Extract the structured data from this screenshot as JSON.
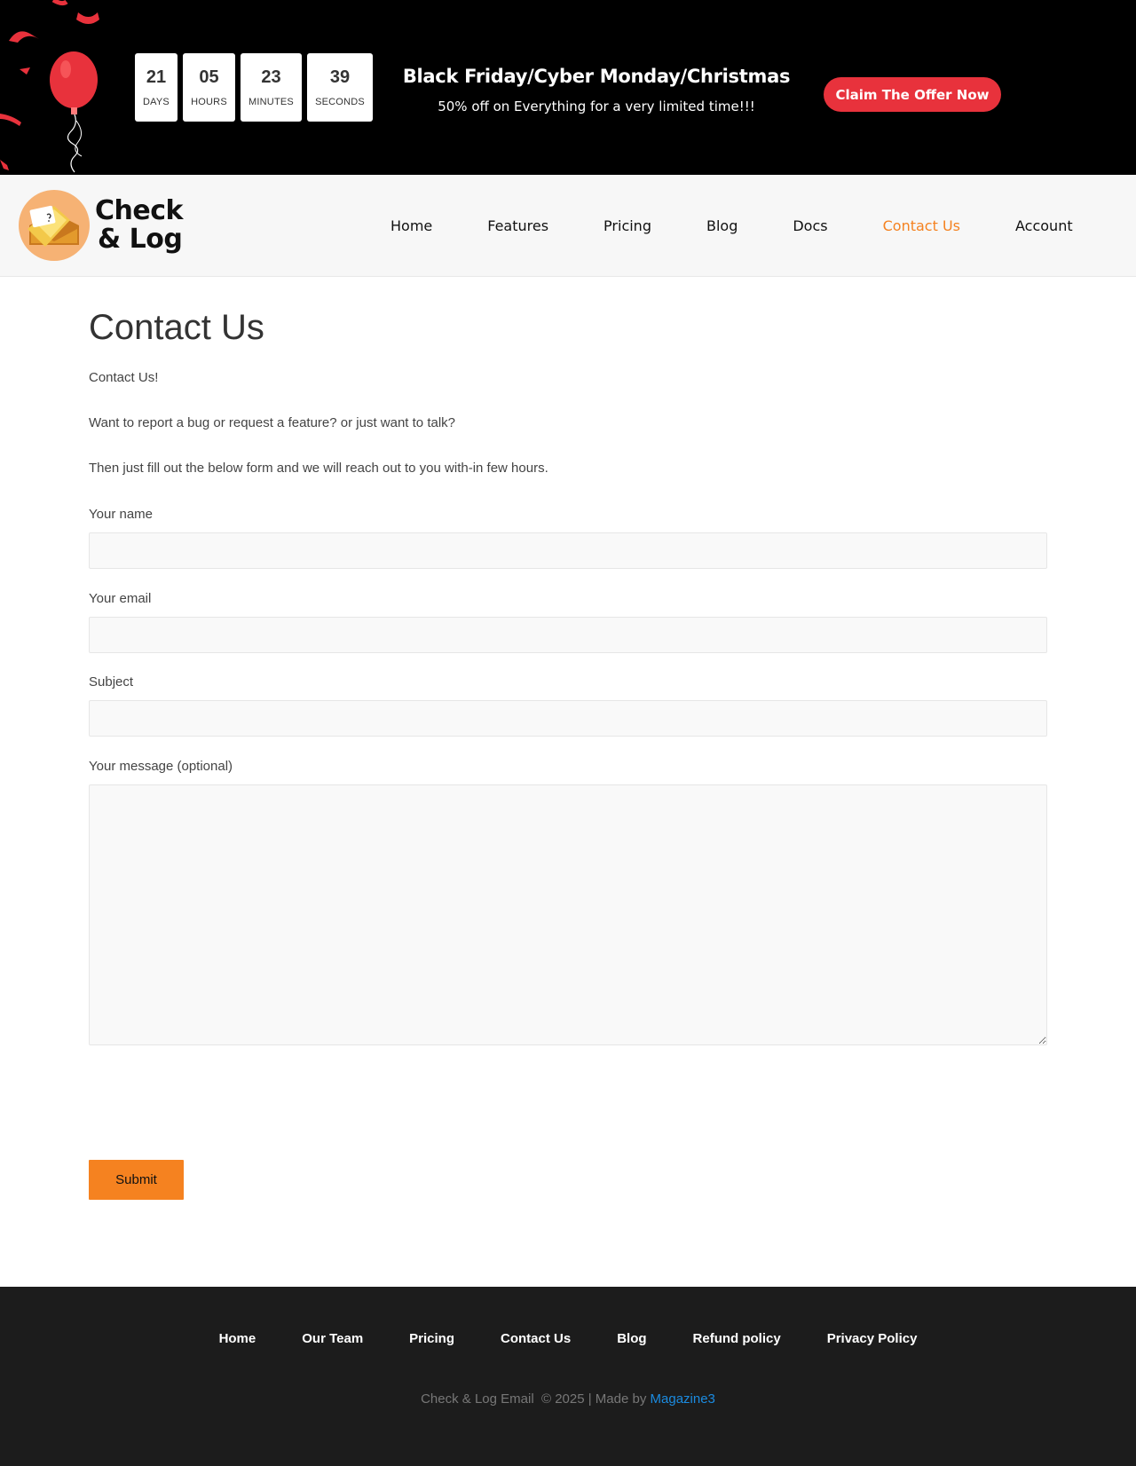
{
  "promo": {
    "countdown": [
      {
        "value": "21",
        "label": "DAYS"
      },
      {
        "value": "05",
        "label": "HOURS"
      },
      {
        "value": "23",
        "label": "MINUTES"
      },
      {
        "value": "39",
        "label": "SECONDS"
      }
    ],
    "title": "Black Friday/Cyber Monday/Christmas",
    "subtitle": "50% off on Everything for a very limited time!!!",
    "cta_label": "Claim The Offer Now",
    "accent": "#e8323c"
  },
  "header": {
    "logo_line1": "Check",
    "logo_line2": "& Log",
    "nav": [
      {
        "label": "Home"
      },
      {
        "label": "Features"
      },
      {
        "label": "Pricing"
      },
      {
        "label": "Blog"
      },
      {
        "label": "Docs"
      },
      {
        "label": "Contact Us",
        "active": true
      },
      {
        "label": "Account"
      }
    ],
    "active_color": "#f58220"
  },
  "main": {
    "title": "Contact Us",
    "intro1": "Contact Us!",
    "intro2": "Want to report a bug or request a feature? or just want to talk?",
    "intro3": "Then just fill out the below form and we will reach out to you with-in few hours.",
    "form": {
      "name_label": "Your name",
      "name_value": "",
      "email_label": "Your email",
      "email_value": "",
      "subject_label": "Subject",
      "subject_value": "",
      "message_label": "Your message (optional)",
      "message_value": "",
      "submit_label": "Submit"
    }
  },
  "footer": {
    "nav": [
      {
        "label": "Home"
      },
      {
        "label": "Our Team"
      },
      {
        "label": "Pricing"
      },
      {
        "label": "Contact Us"
      },
      {
        "label": "Blog"
      },
      {
        "label": "Refund policy"
      },
      {
        "label": "Privacy Policy"
      }
    ],
    "copyright_text": "Check & Log Email  © 2025 | Made by ",
    "credit_link": "Magazine3",
    "link_color": "#1b8be0"
  }
}
